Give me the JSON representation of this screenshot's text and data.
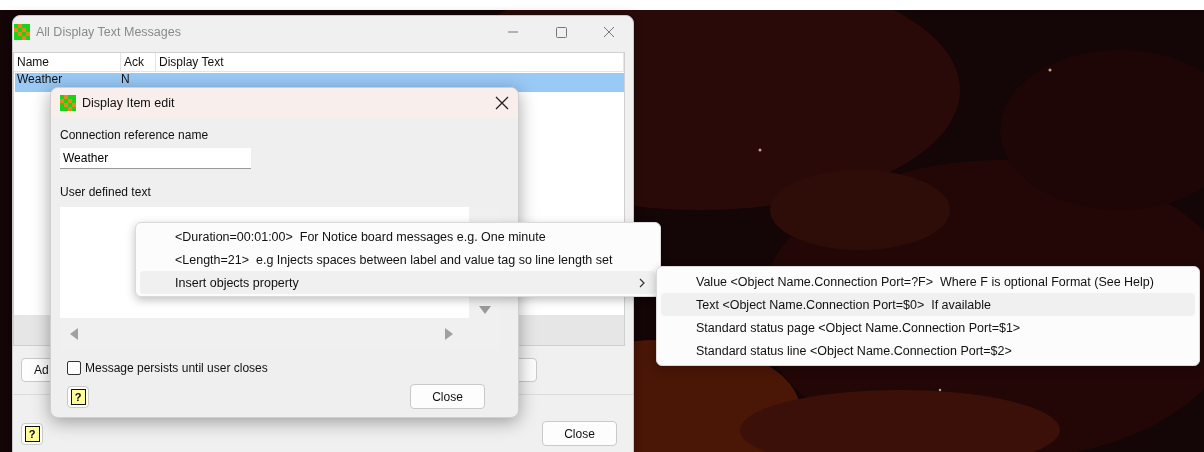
{
  "main_window": {
    "title": "All Display Text Messages",
    "table": {
      "columns": [
        "Name",
        "Ack",
        "Display Text"
      ],
      "rows": [
        {
          "name": "Weather",
          "ack": "N",
          "selected": true
        }
      ]
    },
    "add_button": "Ad",
    "help_button": "?",
    "close_button": "Close"
  },
  "dialog": {
    "title": "Display Item edit",
    "name_label": "Connection reference name",
    "name_value": "Weather",
    "text_label": "User defined text",
    "persist_checkbox": {
      "label": "Message persists until user closes",
      "checked": false
    },
    "help_button": "?",
    "close_button": "Close"
  },
  "context_menu": {
    "items": [
      {
        "label": "<Duration=00:01:00>  For Notice board messages e.g. One minute",
        "highlighted": false,
        "has_submenu": false
      },
      {
        "label": "<Length=21>  e.g Injects spaces between label and value tag so line length set",
        "highlighted": false,
        "has_submenu": false
      },
      {
        "label": "Insert objects property",
        "highlighted": true,
        "has_submenu": true
      }
    ]
  },
  "submenu": {
    "items": [
      {
        "label": "Value <Object Name.Connection Port=?F>  Where F is optional Format (See Help)",
        "highlighted": false
      },
      {
        "label": "Text <Object Name.Connection Port=$0>  If available",
        "highlighted": true
      },
      {
        "label": "Standard status page <Object Name.Connection Port=$1>",
        "highlighted": false
      },
      {
        "label": "Standard status line <Object Name.Connection Port=$2>",
        "highlighted": false
      }
    ]
  }
}
